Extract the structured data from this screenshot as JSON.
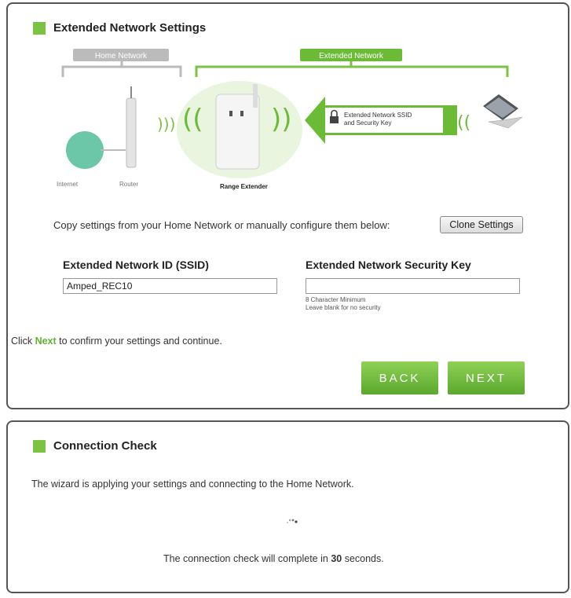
{
  "panel1": {
    "title": "Extended Network Settings",
    "diagram": {
      "home_network_label": "Home Network",
      "extended_network_label": "Extended Network",
      "internet_label": "Internet",
      "router_label": "Router",
      "range_extender_label": "Range Extender",
      "ssid_callout_line1": "Extended Network SSID",
      "ssid_callout_line2": "and Security Key"
    },
    "copy_text": "Copy settings from your Home Network or manually configure them below:",
    "clone_button": "Clone Settings",
    "ssid_label": "Extended Network ID (SSID)",
    "ssid_value": "Amped_REC10",
    "key_label": "Extended Network Security Key",
    "key_value": "",
    "key_hint1": "8 Character Minimum",
    "key_hint2": "Leave blank for no security",
    "confirm_prefix": "Click ",
    "confirm_next": "Next",
    "confirm_suffix": " to confirm your settings and continue.",
    "back_button": "BACK",
    "next_button": "NEXT"
  },
  "panel2": {
    "title": "Connection Check",
    "applying_text": "The wizard is applying your settings and connecting to the Home Network.",
    "complete_prefix": "The connection check will complete in ",
    "seconds_value": "30",
    "complete_suffix": " seconds."
  },
  "colors": {
    "accent_green": "#7cc243",
    "border": "#555555"
  }
}
